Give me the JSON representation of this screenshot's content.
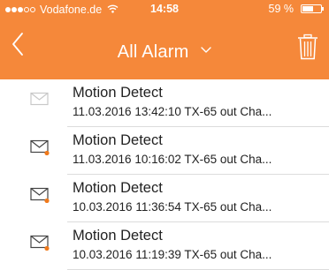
{
  "status_bar": {
    "carrier": "Vodafone.de",
    "time": "14:58",
    "battery_percent": "59 %",
    "signal_bars_filled": 3,
    "signal_bars_total": 5,
    "battery_level": 0.59
  },
  "nav": {
    "title": "All Alarm",
    "back_icon": "chevron-left-icon",
    "dropdown_icon": "chevron-down-icon",
    "trash_icon": "trash-icon"
  },
  "colors": {
    "header": "#f5883a",
    "unread_dot": "#f07a1c",
    "read_envelope": "#c8c8c8",
    "unread_envelope": "#444444",
    "text": "#222222"
  },
  "alarms": [
    {
      "title": "Motion Detect",
      "detail": "11.03.2016 13:42:10  TX-65 out Cha...",
      "unread": false
    },
    {
      "title": "Motion Detect",
      "detail": "11.03.2016 10:16:02  TX-65 out Cha...",
      "unread": true
    },
    {
      "title": "Motion Detect",
      "detail": "10.03.2016 11:36:54  TX-65 out Cha...",
      "unread": true
    },
    {
      "title": "Motion Detect",
      "detail": "10.03.2016 11:19:39  TX-65 out Cha...",
      "unread": true
    }
  ]
}
